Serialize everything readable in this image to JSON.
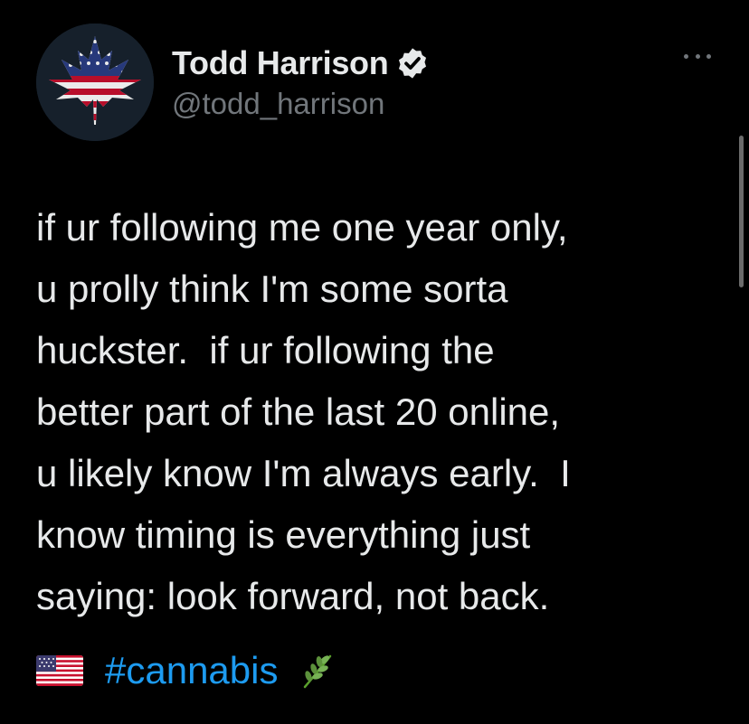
{
  "profile": {
    "display_name": "Todd Harrison",
    "handle": "@todd_harrison",
    "verified": true,
    "avatar": "american-flag-cannabis-leaf"
  },
  "tweet": {
    "lines": [
      "if ur following me one year only,",
      "u prolly think I'm some sorta",
      "huckster.  if ur following the",
      "better part of the last 20 online,",
      "u likely know I'm always early.  I",
      "know timing is everything just",
      "saying: look forward, not back."
    ],
    "flag_emoji": "us-flag-icon",
    "hashtag": "#cannabis",
    "herb_emoji": "herb-icon"
  },
  "colors": {
    "background": "#000000",
    "text": "#e7e9ea",
    "secondary": "#71767b",
    "link": "#1d9bf0"
  }
}
